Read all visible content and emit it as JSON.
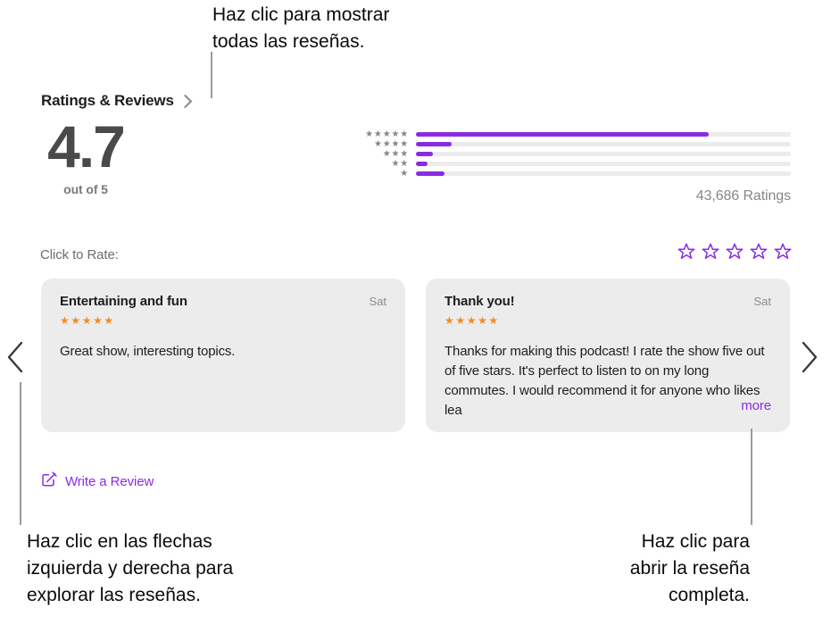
{
  "annotations": {
    "top": "Haz clic para mostrar\ntodas las reseñas.",
    "bottom_left": "Haz clic en las flechas\nizquierda y derecha para\nexplorar las reseñas.",
    "bottom_right": "Haz clic para\nabrir la reseña\ncompleta."
  },
  "header": {
    "title": "Ratings & Reviews",
    "chevron_icon": "chevron-right-icon"
  },
  "summary": {
    "average": "4.7",
    "out_of": "out of 5",
    "ratings_count": "43,686 Ratings"
  },
  "histogram": {
    "rows": [
      {
        "stars": "★★★★★",
        "star_count": 5,
        "percent": 78
      },
      {
        "stars": "★★★★",
        "star_count": 4,
        "percent": 9.5
      },
      {
        "stars": "★★★",
        "star_count": 3,
        "percent": 4.5
      },
      {
        "stars": "★★",
        "star_count": 2,
        "percent": 3
      },
      {
        "stars": "★",
        "star_count": 1,
        "percent": 7.5
      }
    ],
    "fill_color": "#8a2be2",
    "track_color": "#ececec"
  },
  "rate": {
    "label": "Click to Rate:",
    "star_count": 5,
    "star_icon": "star-outline-icon",
    "star_color": "#8a2be2"
  },
  "reviews": [
    {
      "title": "Entertaining and fun",
      "date": "Sat",
      "stars": "★★★★★",
      "rating": 5,
      "body": "Great show, interesting topics.",
      "more_label": null
    },
    {
      "title": "Thank you!",
      "date": "Sat",
      "stars": "★★★★★",
      "rating": 5,
      "body": "Thanks for making this podcast! I rate the show five out of five stars. It's perfect to listen to on my long commutes. I would recommend it for anyone who likes lea",
      "more_label": "more"
    }
  ],
  "nav": {
    "prev_icon": "chevron-left-icon",
    "next_icon": "chevron-right-icon"
  },
  "write_review": {
    "label": "Write a Review",
    "icon": "compose-pencil-icon",
    "color": "#8a2be2"
  }
}
